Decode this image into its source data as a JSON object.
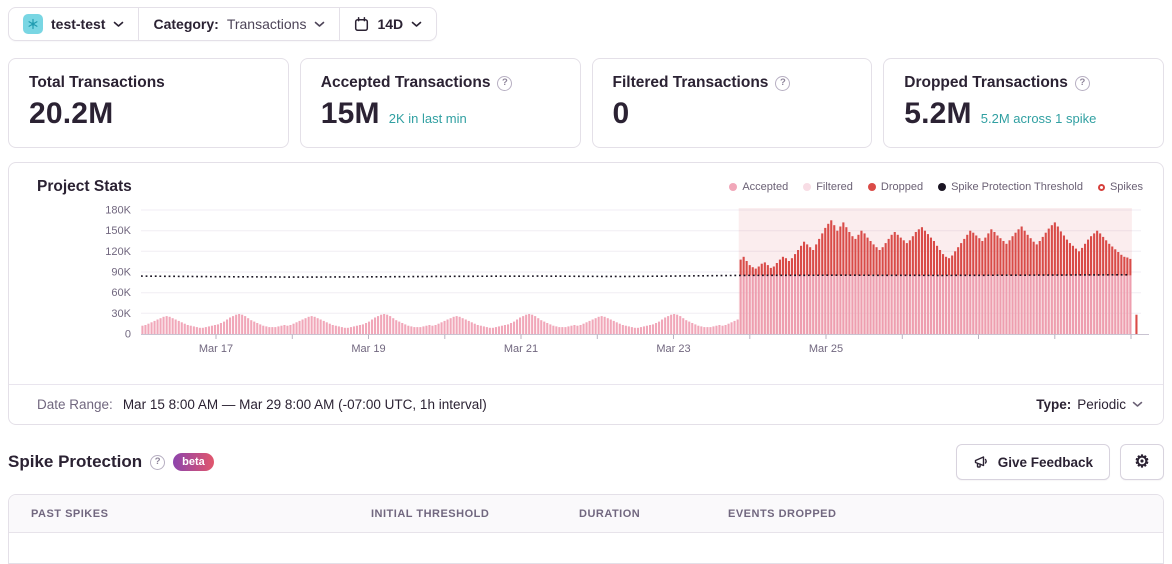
{
  "header": {
    "project": "test-test",
    "category_label": "Category:",
    "category_value": "Transactions",
    "date_range_button": "14D"
  },
  "stats": {
    "cards": [
      {
        "title": "Total Transactions",
        "value": "20.2M",
        "help": false,
        "subtext": ""
      },
      {
        "title": "Accepted Transactions",
        "value": "15M",
        "help": true,
        "subtext": "2K in last min"
      },
      {
        "title": "Filtered Transactions",
        "value": "0",
        "help": true,
        "subtext": ""
      },
      {
        "title": "Dropped Transactions",
        "value": "5.2M",
        "help": true,
        "subtext": "5.2M across 1 spike"
      }
    ]
  },
  "chart_data": {
    "type": "bar",
    "stacked": true,
    "title": "Project Stats",
    "unit": "thousands of transactions (values_k are in K)",
    "interval": "1h",
    "x_start": "Mar 15 8:00 AM",
    "x_end": "Mar 29 8:00 AM",
    "ylim_k": [
      0,
      180
    ],
    "y_tick_values_k": [
      180,
      150,
      120,
      90,
      60,
      30,
      0
    ],
    "y_tick_labels": [
      "180K",
      "150K",
      "120K",
      "90K",
      "60K",
      "30K",
      "0"
    ],
    "x_labels": [
      {
        "f": 0.075,
        "label": "Mar 17"
      },
      {
        "f": 0.2275,
        "label": "Mar 19"
      },
      {
        "f": 0.38,
        "label": "Mar 21"
      },
      {
        "f": 0.5325,
        "label": "Mar 23"
      },
      {
        "f": 0.685,
        "label": "Mar 25"
      }
    ],
    "x_minor_tick_fractions": [
      0.075,
      0.15125,
      0.2275,
      0.30375,
      0.38,
      0.45625,
      0.5325,
      0.60875,
      0.685,
      0.76125,
      0.8375,
      0.91375,
      0.99
    ],
    "legend": [
      {
        "label": "Accepted",
        "color": "#f1a7b9",
        "marker": "dot"
      },
      {
        "label": "Filtered",
        "color": "#f8dde5",
        "marker": "dot"
      },
      {
        "label": "Dropped",
        "color": "#da4b47",
        "marker": "dot"
      },
      {
        "label": "Spike Protection Threshold",
        "color": "#1a1523",
        "marker": "dot"
      },
      {
        "label": "Spikes",
        "color": "#d6403c",
        "marker": "ring"
      }
    ],
    "threshold_points_fk": [
      [
        0,
        84
      ],
      [
        0.08,
        83.2
      ],
      [
        0.16,
        82.6
      ],
      [
        0.24,
        83
      ],
      [
        0.32,
        83.8
      ],
      [
        0.4,
        84
      ],
      [
        0.48,
        83.4
      ],
      [
        0.55,
        84.3
      ],
      [
        0.6,
        85
      ],
      [
        0.7,
        85.4
      ],
      [
        0.8,
        85
      ],
      [
        0.9,
        85.5
      ],
      [
        0.988,
        86
      ]
    ],
    "spike_region": {
      "start_index": 198,
      "end_index": 328,
      "overlay_color": "rgba(219,74,87,0.10)",
      "dropped_total": "5.2M",
      "spike_count": 1
    },
    "series": [
      {
        "name": "Accepted",
        "color": "#f1a7b9",
        "values_k": [
          12,
          13,
          15,
          17,
          19,
          21,
          23,
          25,
          26,
          25,
          23,
          21,
          19,
          17,
          15,
          13,
          12,
          11,
          10,
          9,
          9,
          10,
          11,
          12,
          13,
          14,
          16,
          18,
          21,
          24,
          26,
          28,
          29,
          28,
          26,
          23,
          20,
          18,
          16,
          14,
          12,
          11,
          10,
          10,
          10,
          11,
          12,
          13,
          12,
          13,
          15,
          17,
          19,
          21,
          23,
          25,
          26,
          25,
          23,
          21,
          19,
          17,
          15,
          13,
          12,
          11,
          10,
          9,
          9,
          10,
          11,
          12,
          13,
          14,
          16,
          18,
          21,
          24,
          26,
          28,
          29,
          28,
          26,
          23,
          20,
          18,
          16,
          14,
          12,
          11,
          10,
          10,
          10,
          11,
          12,
          13,
          12,
          13,
          15,
          17,
          19,
          21,
          23,
          25,
          26,
          25,
          23,
          21,
          19,
          17,
          15,
          13,
          12,
          11,
          10,
          9,
          9,
          10,
          11,
          12,
          13,
          14,
          16,
          18,
          21,
          24,
          26,
          28,
          29,
          28,
          26,
          23,
          20,
          18,
          16,
          14,
          12,
          11,
          10,
          10,
          10,
          11,
          12,
          13,
          12,
          13,
          15,
          17,
          19,
          21,
          23,
          25,
          26,
          25,
          23,
          21,
          19,
          17,
          15,
          13,
          12,
          11,
          10,
          9,
          9,
          10,
          11,
          12,
          13,
          14,
          16,
          18,
          21,
          24,
          26,
          28,
          29,
          28,
          26,
          23,
          20,
          18,
          16,
          14,
          12,
          11,
          10,
          10,
          10,
          11,
          12,
          13,
          12,
          13,
          15,
          17,
          19,
          21,
          85,
          85,
          85,
          85,
          85,
          85,
          85,
          85,
          85,
          85,
          85,
          85,
          85,
          85,
          85,
          85,
          85,
          85,
          85,
          85,
          85,
          85,
          85,
          85,
          85,
          85,
          85,
          85,
          85,
          85,
          85,
          85,
          85,
          85,
          85,
          85,
          85,
          85,
          85,
          85,
          85,
          85,
          85,
          85,
          85,
          85,
          85,
          85,
          85,
          85,
          85,
          85,
          85,
          85,
          85,
          85,
          85,
          85,
          85,
          85,
          85,
          85,
          85,
          85,
          85,
          85,
          85,
          85,
          85,
          85,
          85,
          85,
          85,
          85,
          85,
          85,
          85,
          85,
          85,
          85,
          85,
          85,
          85,
          85,
          85,
          85,
          85,
          85,
          85,
          85,
          85,
          85,
          85,
          85,
          85,
          85,
          85,
          85,
          85,
          85,
          85,
          85,
          85,
          85,
          85,
          85,
          85,
          85,
          85,
          85,
          85,
          85,
          85,
          85,
          85,
          85,
          85,
          85,
          85,
          85,
          85,
          85,
          85,
          85,
          85,
          85,
          85,
          85,
          85,
          85,
          0,
          0,
          0
        ]
      },
      {
        "name": "Dropped",
        "color": "#da4b47",
        "start_index": 198,
        "values_k": [
          23,
          27,
          21,
          15,
          12,
          10,
          13,
          17,
          19,
          15,
          11,
          13,
          18,
          23,
          27,
          25,
          21,
          25,
          31,
          37,
          43,
          49,
          45,
          41,
          37,
          45,
          53,
          61,
          69,
          75,
          80,
          73,
          65,
          71,
          77,
          70,
          63,
          57,
          53,
          59,
          65,
          61,
          55,
          50,
          45,
          41,
          37,
          41,
          47,
          53,
          59,
          63,
          59,
          55,
          51,
          47,
          51,
          57,
          63,
          67,
          70,
          65,
          60,
          55,
          50,
          43,
          37,
          31,
          27,
          25,
          29,
          35,
          41,
          47,
          53,
          59,
          65,
          62,
          58,
          54,
          50,
          55,
          61,
          67,
          63,
          58,
          54,
          50,
          46,
          51,
          57,
          62,
          67,
          71,
          65,
          59,
          54,
          49,
          45,
          50,
          56,
          62,
          68,
          73,
          77,
          71,
          64,
          58,
          52,
          47,
          43,
          39,
          35,
          40,
          46,
          52,
          57,
          61,
          65,
          61,
          56,
          51,
          46,
          42,
          38,
          34,
          30,
          27,
          26,
          24,
          0,
          28,
          0
        ]
      }
    ]
  },
  "footer": {
    "date_range_label": "Date Range:",
    "date_range_value": "Mar 15 8:00 AM — Mar 29 8:00 AM (-07:00 UTC, 1h interval)",
    "type_label": "Type:",
    "type_value": "Periodic"
  },
  "spike_section": {
    "title": "Spike Protection",
    "beta_badge": "beta",
    "feedback_button": "Give Feedback"
  },
  "table": {
    "headers": [
      "PAST SPIKES",
      "INITIAL THRESHOLD",
      "DURATION",
      "EVENTS DROPPED"
    ]
  }
}
